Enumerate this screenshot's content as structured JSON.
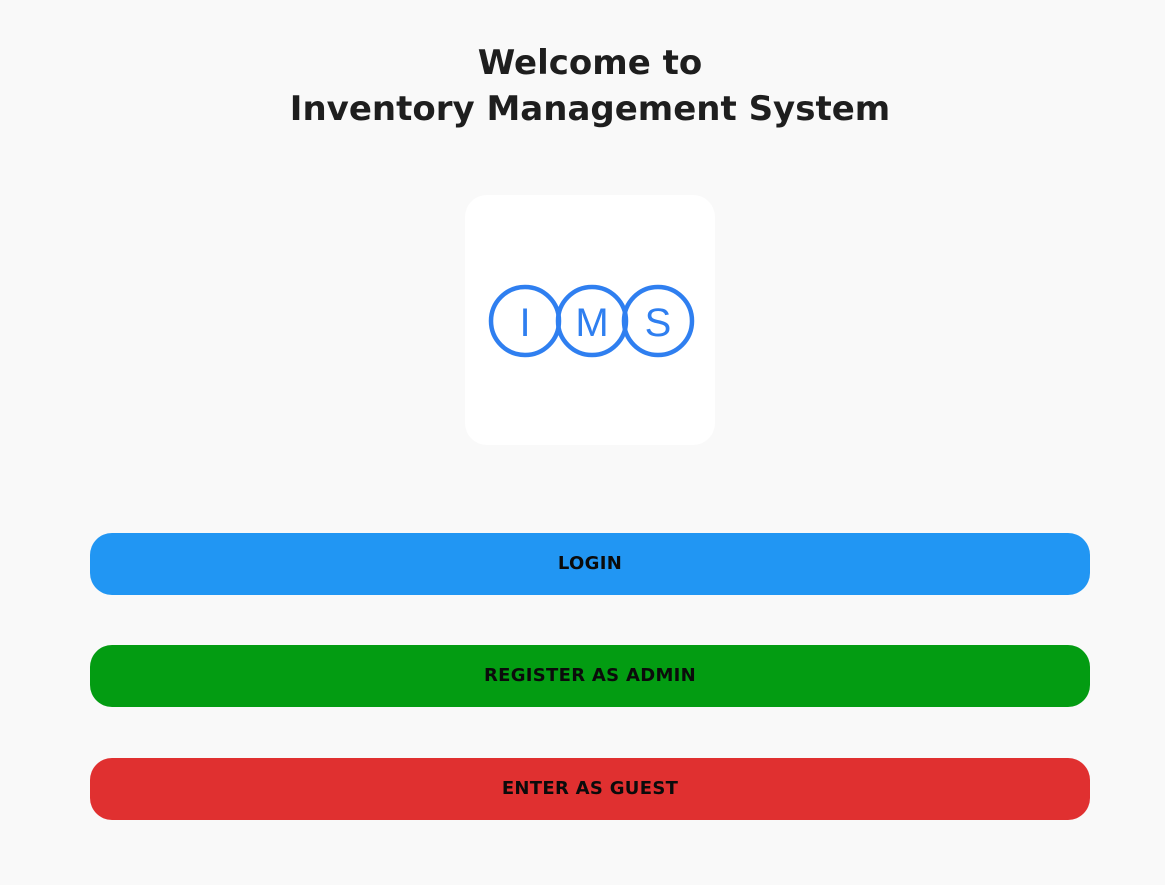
{
  "header": {
    "line1": "Welcome to",
    "line2": "Inventory Management System"
  },
  "logo": {
    "text": "IMS",
    "letters": [
      "I",
      "M",
      "S"
    ],
    "color": "#2f7ff0",
    "icon": "ims-logo"
  },
  "buttons": {
    "login": {
      "label": "LOGIN",
      "color": "#2196f3"
    },
    "register_admin": {
      "label": "REGISTER AS ADMIN",
      "color": "#039c12"
    },
    "guest": {
      "label": "ENTER AS GUEST",
      "color": "#e03030"
    }
  }
}
